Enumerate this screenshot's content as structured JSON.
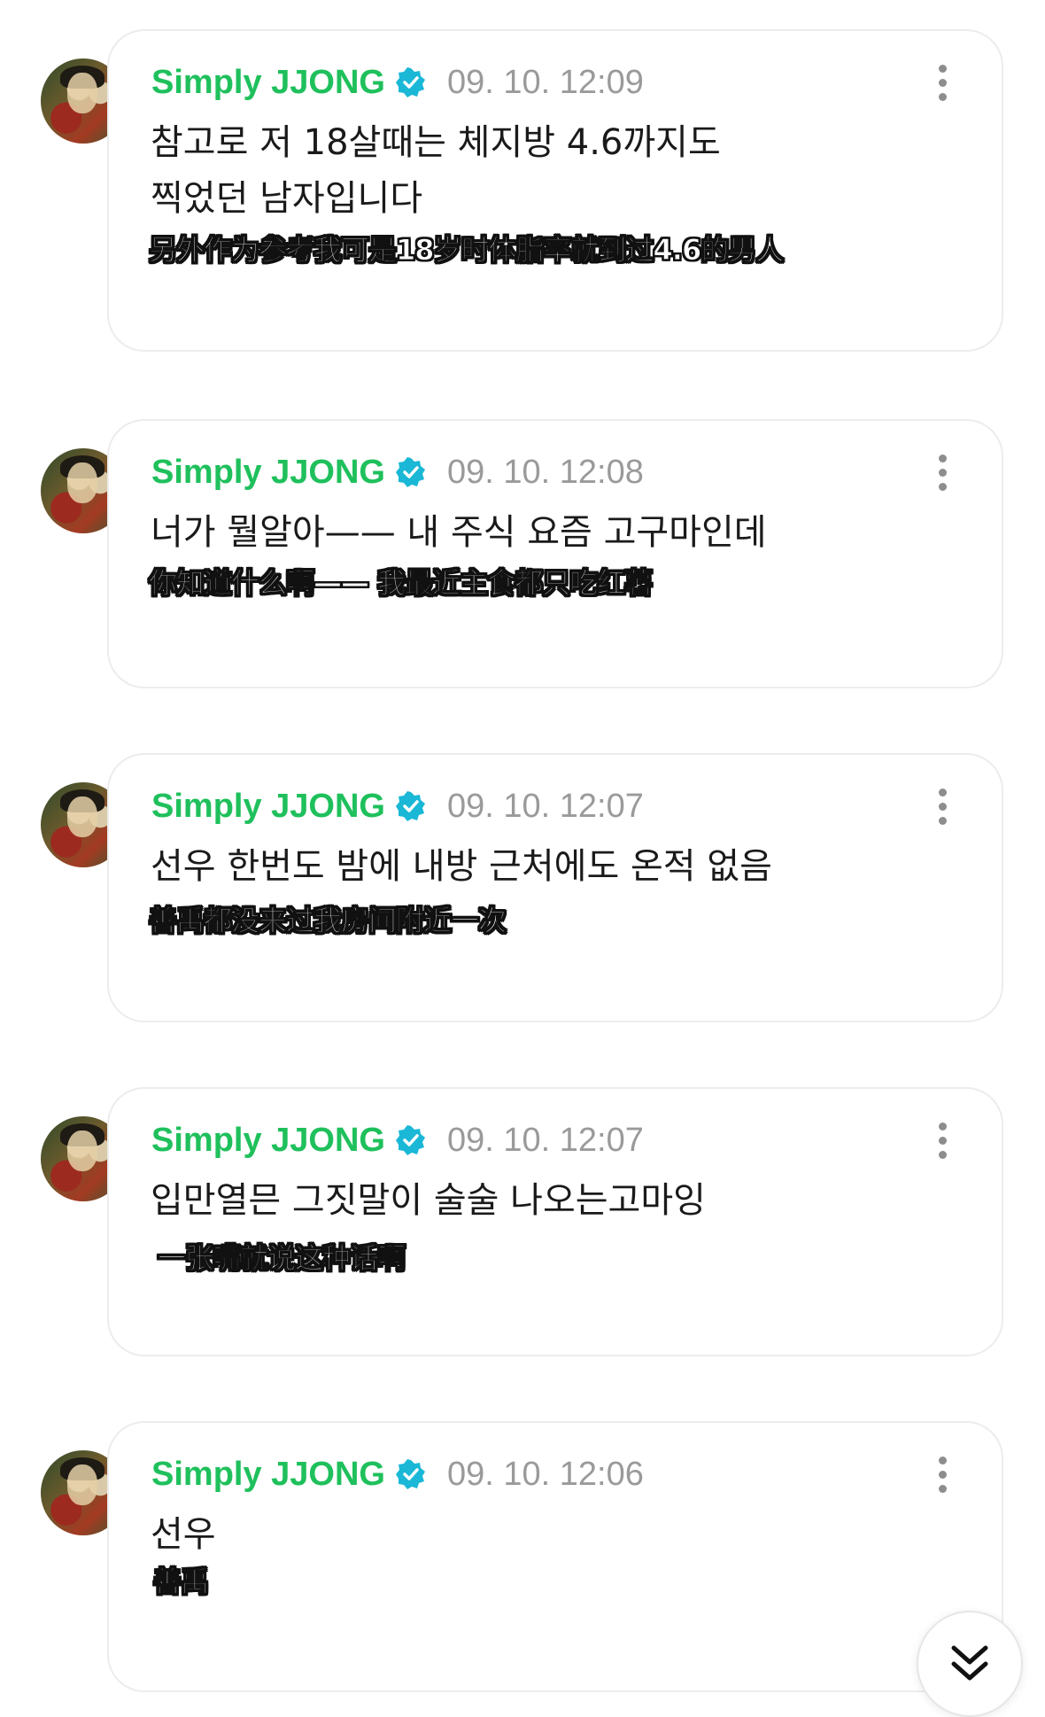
{
  "posts": [
    {
      "author": "Simply JJONG",
      "timestamp": "09. 10. 12:09",
      "text_lines": [
        "참고로 저 18살때는 체지방 4.6까지도",
        "찍었던 남자입니다"
      ],
      "subtitle": "另外作为参考我可是18岁时体脂率就到过4.6的男人"
    },
    {
      "author": "Simply JJONG",
      "timestamp": "09. 10. 12:08",
      "text_lines": [
        "너가 뭘알아—— 내 주식 요즘 고구마인데"
      ],
      "subtitle": "你知道什么啊—— 我最近主食都只吃红薯"
    },
    {
      "author": "Simply JJONG",
      "timestamp": "09. 10. 12:07",
      "text_lines": [
        "선우 한번도 밤에 내방 근처에도 온적 없음"
      ],
      "subtitle": "善禹都没来过我房间附近一次"
    },
    {
      "author": "Simply JJONG",
      "timestamp": "09. 10. 12:07",
      "text_lines": [
        "입만열믄 그짓말이 술술 나오는고마잉"
      ],
      "subtitle": "一张嘴就说这种话啊"
    },
    {
      "author": "Simply JJONG",
      "timestamp": "09. 10. 12:06",
      "text_lines": [
        "선우"
      ],
      "subtitle": "善禹"
    }
  ],
  "icons": {
    "verified": "verified-badge-icon",
    "more": "more-vertical-icon",
    "scroll": "double-chevron-down-icon"
  },
  "colors": {
    "author": "#1fc05c",
    "verified": "#1ab8d6",
    "timestamp": "#9a9a9a",
    "card_border": "#ececec"
  }
}
